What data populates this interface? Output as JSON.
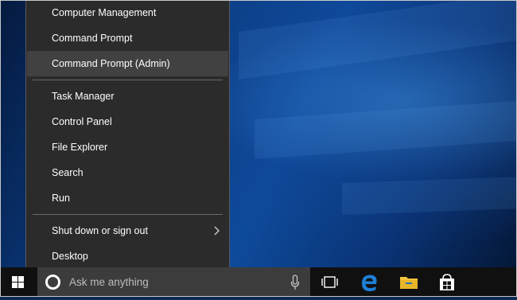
{
  "menu": {
    "items": [
      {
        "label": "Computer Management"
      },
      {
        "label": "Command Prompt"
      },
      {
        "label": "Command Prompt (Admin)"
      },
      {
        "label": "Task Manager"
      },
      {
        "label": "Control Panel"
      },
      {
        "label": "File Explorer"
      },
      {
        "label": "Search"
      },
      {
        "label": "Run"
      },
      {
        "label": "Shut down or sign out"
      },
      {
        "label": "Desktop"
      }
    ],
    "highlighted": "Command Prompt (Admin)",
    "submenu_icon": "chevron-right-icon"
  },
  "taskbar": {
    "search_placeholder": "Ask me anything",
    "icons": [
      "windows-logo-icon",
      "cortana-icon",
      "microphone-icon",
      "task-view-icon",
      "edge-icon",
      "file-explorer-icon",
      "store-icon"
    ]
  },
  "colors": {
    "menu_bg": "#2b2b2b",
    "menu_highlight": "#414141",
    "taskbar_bg": "#101010",
    "search_bg": "#3c3c3c",
    "edge_blue": "#1e7fd6",
    "folder_yellow": "#f3c43c"
  }
}
